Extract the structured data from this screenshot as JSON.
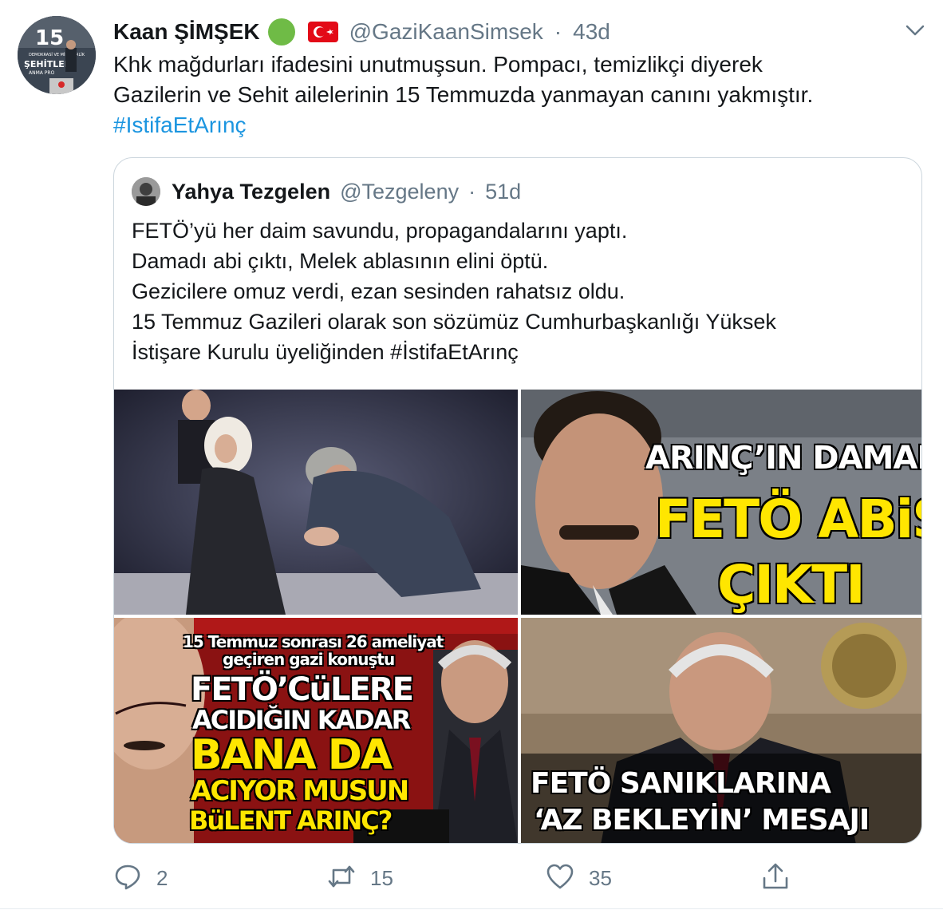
{
  "tweet": {
    "author_name": "Kaan ŞİMŞEK",
    "handle": "@GaziKaanSimsek",
    "separator": "·",
    "time": "43d",
    "text_lines": [
      "Khk mağdurları ifadesini unutmuşsun. Pompacı, temizlikçi diyerek",
      "Gazilerin ve Sehit ailelerinin 15 Temmuzda yanmayan canını yakmıştır."
    ],
    "hashtag": "#IstifaEtArınç",
    "avatar_text": {
      "number": "15",
      "line1": "DEMOKRASİ VE MİLLİ BİRLİK",
      "title": "ŞEHİTLER",
      "line2": "ANMA PRO"
    }
  },
  "quoted": {
    "author_name": "Yahya Tezgelen",
    "handle": "@Tezgeleny",
    "separator": "·",
    "time": "51d",
    "text_lines": [
      "FETÖ’yü her daim savundu, propagandalarını yaptı.",
      "Damadı abi çıktı, Melek ablasının elini öptü.",
      "Gezicilere omuz verdi, ezan sesinden rahatsız oldu.",
      "15 Temmuz Gazileri olarak son sözümüz Cumhurbaşkanlığı Yüksek",
      "İstişare Kurulu üyeliğinden #İstifaEtArınç"
    ],
    "images": {
      "img2": {
        "line1": "ARINÇ’IN DAMADI",
        "line2": "FETÖ ABiSi",
        "line3": "ÇIKTI"
      },
      "img3": {
        "line1": "15 Temmuz sonrası 26 ameliyat",
        "line2": "geçiren gazi konuştu",
        "line3": "FETÖ’CüLERE",
        "line4": "ACIDIĞIN KADAR",
        "line5": "BANA DA",
        "line6": "ACIYOR MUSUN",
        "line7": "BüLENT ARINÇ?"
      },
      "img4": {
        "line1": "FETÖ SANIKLARINA",
        "line2": "‘AZ BEKLEYİN’ MESAJI"
      }
    }
  },
  "actions": {
    "reply_count": "2",
    "retweet_count": "15",
    "like_count": "35"
  },
  "colors": {
    "link": "#1b95e0",
    "secondary_text": "#657786",
    "border": "#ccd6dd"
  },
  "icons": [
    "verified-emoji-icon",
    "turkey-flag-icon",
    "chevron-down-icon",
    "reply-icon",
    "retweet-icon",
    "like-icon",
    "share-icon"
  ]
}
